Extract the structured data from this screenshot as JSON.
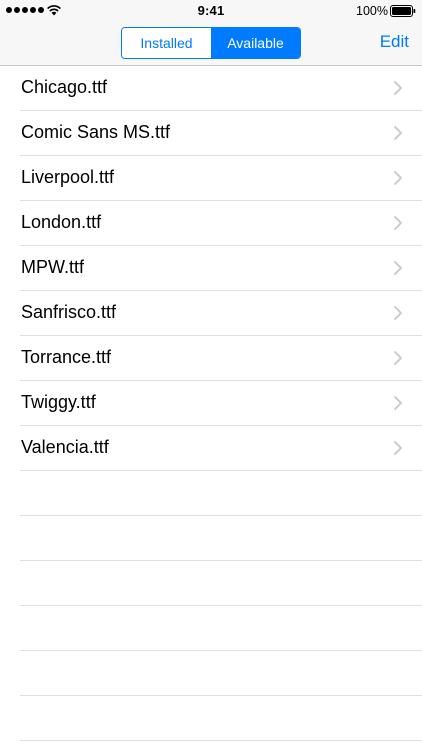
{
  "status_bar": {
    "time": "9:41",
    "battery_percent": "100%",
    "icons": [
      "signal-dots-icon",
      "wifi-icon",
      "battery-icon"
    ]
  },
  "nav_bar": {
    "segments": [
      {
        "label": "Installed",
        "selected": false
      },
      {
        "label": "Available",
        "selected": true
      }
    ],
    "edit_label": "Edit"
  },
  "fonts_list": {
    "items": [
      {
        "label": "Chicago.ttf"
      },
      {
        "label": "Comic Sans MS.ttf"
      },
      {
        "label": "Liverpool.ttf"
      },
      {
        "label": "London.ttf"
      },
      {
        "label": "MPW.ttf"
      },
      {
        "label": "Sanfrisco.ttf"
      },
      {
        "label": "Torrance.ttf"
      },
      {
        "label": "Twiggy.ttf"
      },
      {
        "label": "Valencia.ttf"
      }
    ],
    "chevron_icon": "chevron-right-icon"
  },
  "colors": {
    "accent": "#007aff",
    "separator": "#e0e0e3",
    "bar_background": "#f7f7f7",
    "chevron": "#c7c7cc"
  }
}
